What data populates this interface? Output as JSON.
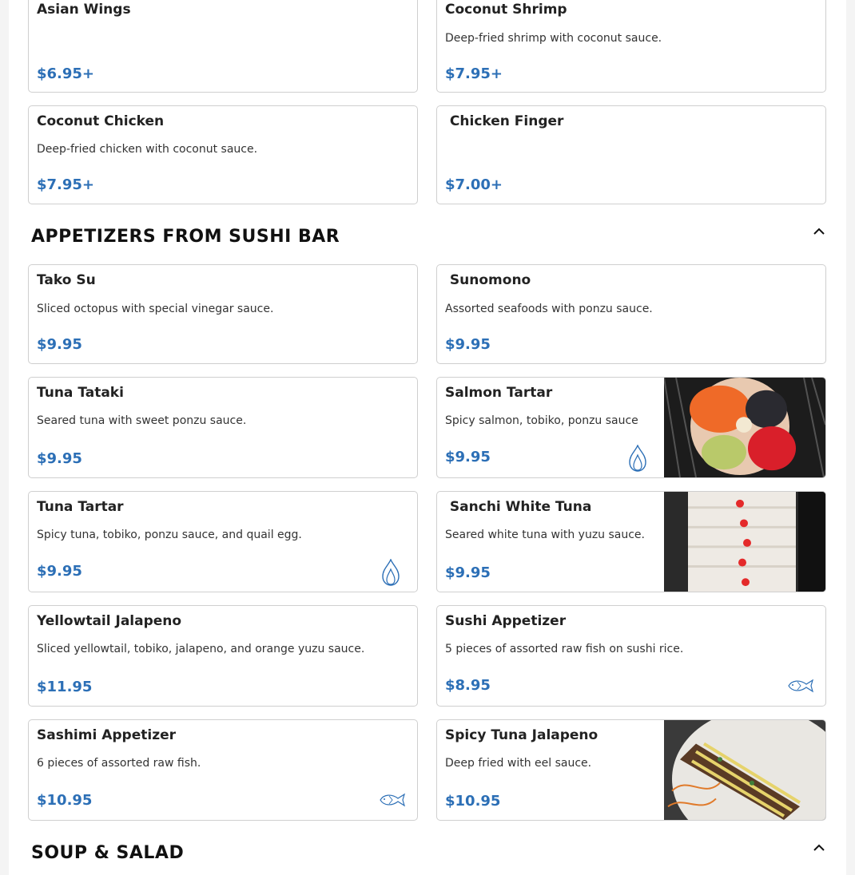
{
  "sections": [
    {
      "title": "APPETIZERS FROM SUSHI BAR"
    },
    {
      "title": "SOUP & SALAD"
    }
  ],
  "items": {
    "asian_wings": {
      "name": "Asian Wings",
      "price": "$6.95+"
    },
    "coconut_shrimp": {
      "name": "Coconut Shrimp",
      "desc": "Deep-fried shrimp with coconut sauce.",
      "price": "$7.95+"
    },
    "coconut_chicken": {
      "name": "Coconut Chicken",
      "desc": "Deep-fried chicken with coconut sauce.",
      "price": "$7.95+"
    },
    "chicken_finger": {
      "name": " Chicken Finger",
      "price": "$7.00+"
    },
    "tako_su": {
      "name": "Tako Su",
      "desc": "Sliced octopus with special vinegar sauce.",
      "price": "$9.95"
    },
    "sunomono": {
      "name": " Sunomono",
      "desc": "Assorted seafoods with ponzu sauce.",
      "price": "$9.95"
    },
    "tuna_tataki": {
      "name": "Tuna Tataki",
      "desc": "Seared tuna with sweet ponzu sauce.",
      "price": "$9.95"
    },
    "salmon_tartar": {
      "name": "Salmon Tartar",
      "desc": "Spicy salmon, tobiko, ponzu sauce",
      "price": "$9.95",
      "icon": "spicy-flame-icon"
    },
    "tuna_tartar": {
      "name": "Tuna Tartar",
      "desc": "Spicy tuna, tobiko, ponzu sauce, and quail egg.",
      "price": "$9.95",
      "icon": "spicy-flame-icon"
    },
    "sanchi_white_tuna": {
      "name": " Sanchi White Tuna",
      "desc": "Seared white tuna with yuzu sauce.",
      "price": "$9.95"
    },
    "yellowtail_jalapeno": {
      "name": "Yellowtail Jalapeno",
      "desc": "Sliced yellowtail, tobiko, jalapeno, and orange yuzu sauce.",
      "price": "$11.95"
    },
    "sushi_appetizer": {
      "name": "Sushi Appetizer",
      "desc": "5 pieces of assorted raw fish on sushi rice.",
      "price": "$8.95",
      "icon": "raw-fish-icon"
    },
    "sashimi_appetizer": {
      "name": "Sashimi Appetizer",
      "desc": "6 pieces of assorted raw fish.",
      "price": "$10.95",
      "icon": "raw-fish-icon"
    },
    "spicy_tuna_jalapeno": {
      "name": "Spicy Tuna Jalapeno",
      "desc": "Deep fried with eel sauce.",
      "price": "$10.95"
    }
  },
  "colors": {
    "price": "#2c6fb6",
    "icon": "#2c6fb6",
    "border": "#cfcfcf"
  }
}
